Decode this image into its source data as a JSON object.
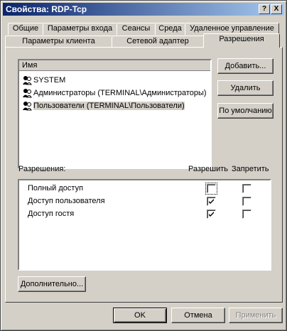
{
  "window": {
    "title": "Свойства: RDP-Tcp",
    "help_label": "?",
    "close_label": "X"
  },
  "tabs_row1": [
    "Общие",
    "Параметры входа",
    "Сеансы",
    "Среда",
    "Удаленное управление"
  ],
  "tabs_row2": [
    "Параметры клиента",
    "Сетевой адаптер",
    "Разрешения"
  ],
  "users": {
    "column_header": "Имя",
    "items": [
      {
        "label": "SYSTEM",
        "selected": false
      },
      {
        "label": "Администраторы (TERMINAL\\Администраторы)",
        "selected": false
      },
      {
        "label": "Пользователи (TERMINAL\\Пользователи)",
        "selected": true
      }
    ]
  },
  "side_buttons": {
    "add": "Добавить...",
    "remove": "Удалить",
    "default": "По умолчанию"
  },
  "permissions": {
    "title": "Разрешения:",
    "allow_header": "Разрешить",
    "deny_header": "Запретить",
    "items": [
      {
        "label": "Полный доступ",
        "allow": false,
        "deny": false
      },
      {
        "label": "Доступ пользователя",
        "allow": true,
        "deny": false
      },
      {
        "label": "Доступ гостя",
        "allow": true,
        "deny": false
      }
    ]
  },
  "advanced_button": "Дополнительно...",
  "footer": {
    "ok": "OK",
    "cancel": "Отмена",
    "apply": "Применить"
  },
  "colors": {
    "title_gradient_start": "#0a246a",
    "title_gradient_end": "#a6caf0",
    "face": "#d4d0c8"
  }
}
